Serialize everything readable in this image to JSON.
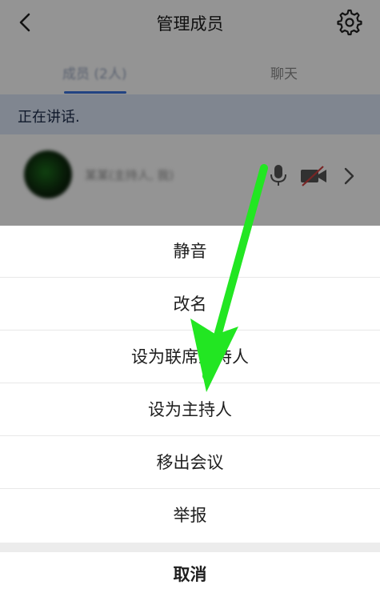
{
  "navbar": {
    "title": "管理成员",
    "back_icon": "chevron-left-icon",
    "settings_icon": "gear-icon"
  },
  "tabs": {
    "members": "成员 (2人)",
    "chat": "聊天",
    "active_color": "#3b74e0"
  },
  "speaking": {
    "label": "正在讲话."
  },
  "member": {
    "name": "某某(主持人, 我)",
    "icons": [
      "microphone-icon",
      "camera-off-icon",
      "chevron-right-icon"
    ]
  },
  "action_sheet": {
    "items": [
      "静音",
      "改名",
      "设为联席主持人",
      "设为主持人",
      "移出会议",
      "举报"
    ],
    "cancel": "取消"
  },
  "annotation": {
    "arrow_color": "#22e622"
  }
}
